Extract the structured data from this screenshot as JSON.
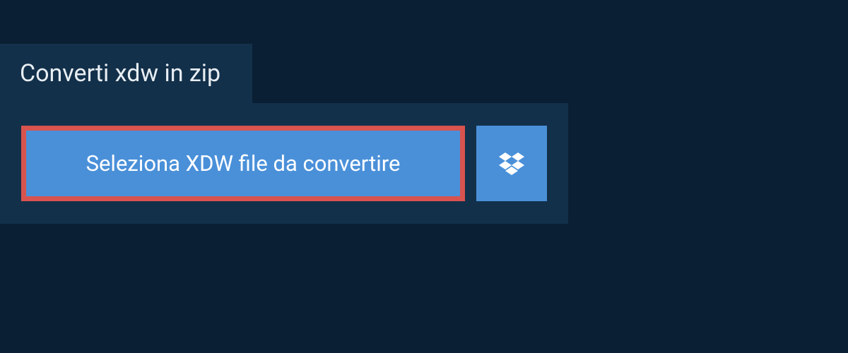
{
  "tab": {
    "label": "Converti xdw in zip"
  },
  "upload": {
    "select_label": "Seleziona XDW file da convertire"
  },
  "colors": {
    "background": "#0a1f33",
    "panel": "#13304a",
    "button": "#4a90d9",
    "highlight_border": "#d9534f",
    "text_light": "#ffffff"
  }
}
